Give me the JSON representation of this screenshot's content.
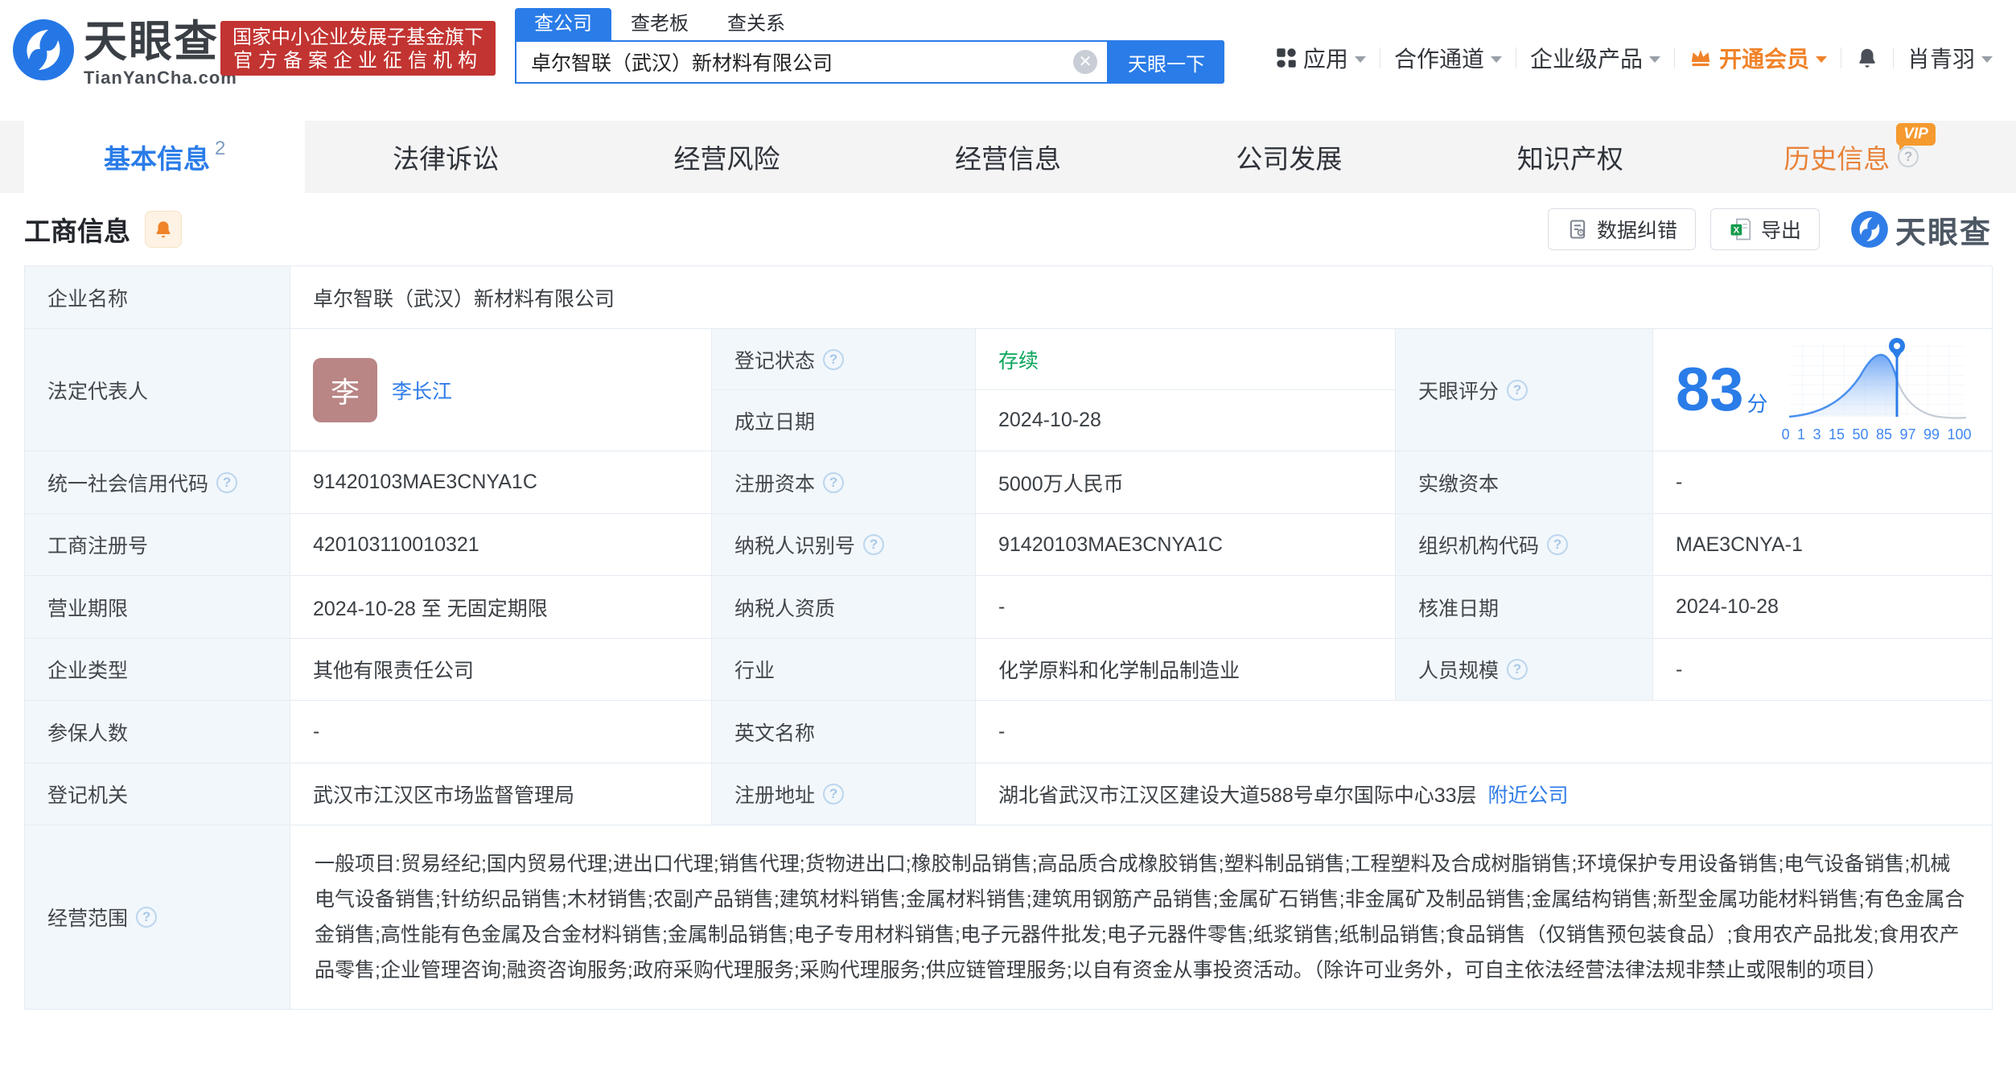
{
  "header": {
    "brand": {
      "name": "天眼查",
      "domain": "TianYanCha.com"
    },
    "badge": {
      "line1": "国家中小企业发展子基金旗下",
      "line2": "官方备案企业征信机构"
    },
    "search": {
      "tabs": [
        {
          "label": "查公司"
        },
        {
          "label": "查老板"
        },
        {
          "label": "查关系"
        }
      ],
      "value": "卓尔智联（武汉）新材料有限公司",
      "button": "天眼一下"
    },
    "nav": {
      "apps": "应用",
      "partner": "合作通道",
      "enterprise": "企业级产品",
      "vip": "开通会员",
      "user": "肖青羽"
    }
  },
  "tabs": [
    {
      "label": "基本信息",
      "count": "2"
    },
    {
      "label": "法律诉讼"
    },
    {
      "label": "经营风险"
    },
    {
      "label": "经营信息"
    },
    {
      "label": "公司发展"
    },
    {
      "label": "知识产权"
    },
    {
      "label": "历史信息",
      "badge": "VIP"
    }
  ],
  "section": {
    "title": "工商信息",
    "correct_button": "数据纠错",
    "export_button": "导出",
    "watermark": "天眼查"
  },
  "fields": {
    "company_name": {
      "label": "企业名称",
      "value": "卓尔智联（武汉）新材料有限公司"
    },
    "legal_rep": {
      "label": "法定代表人",
      "avatar_char": "李",
      "name": "李长江"
    },
    "reg_status": {
      "label": "登记状态",
      "value": "存续"
    },
    "establish_date": {
      "label": "成立日期",
      "value": "2024-10-28"
    },
    "score": {
      "label": "天眼评分",
      "value": "83",
      "unit": "分",
      "axis": [
        "0",
        "1",
        "3",
        "15",
        "50",
        "85",
        "97",
        "99",
        "100"
      ]
    },
    "credit_code": {
      "label": "统一社会信用代码",
      "value": "91420103MAE3CNYA1C"
    },
    "reg_capital": {
      "label": "注册资本",
      "value": "5000万人民币"
    },
    "paid_capital": {
      "label": "实缴资本",
      "value": "-"
    },
    "reg_no": {
      "label": "工商注册号",
      "value": "420103110010321"
    },
    "taxpayer_no": {
      "label": "纳税人识别号",
      "value": "91420103MAE3CNYA1C"
    },
    "org_code": {
      "label": "组织机构代码",
      "value": "MAE3CNYA-1"
    },
    "term": {
      "label": "营业期限",
      "value": "2024-10-28 至 无固定期限"
    },
    "taxpayer_qualification": {
      "label": "纳税人资质",
      "value": "-"
    },
    "approve_date": {
      "label": "核准日期",
      "value": "2024-10-28"
    },
    "company_type": {
      "label": "企业类型",
      "value": "其他有限责任公司"
    },
    "industry": {
      "label": "行业",
      "value": "化学原料和化学制品制造业"
    },
    "staff_scale": {
      "label": "人员规模",
      "value": "-"
    },
    "insured_num": {
      "label": "参保人数",
      "value": "-"
    },
    "english_name": {
      "label": "英文名称",
      "value": "-"
    },
    "registry": {
      "label": "登记机关",
      "value": "武汉市江汉区市场监督管理局"
    },
    "address": {
      "label": "注册地址",
      "value": "湖北省武汉市江汉区建设大道588号卓尔国际中心33层",
      "nearby_link": "附近公司"
    },
    "scope": {
      "label": "经营范围",
      "value": "一般项目:贸易经纪;国内贸易代理;进出口代理;销售代理;货物进出口;橡胶制品销售;高品质合成橡胶销售;塑料制品销售;工程塑料及合成树脂销售;环境保护专用设备销售;电气设备销售;机械电气设备销售;针纺织品销售;木材销售;农副产品销售;建筑材料销售;金属材料销售;建筑用钢筋产品销售;金属矿石销售;非金属矿及制品销售;金属结构销售;新型金属功能材料销售;有色金属合金销售;高性能有色金属及合金材料销售;金属制品销售;电子专用材料销售;电子元器件批发;电子元器件零售;纸浆销售;纸制品销售;食品销售（仅销售预包装食品）;食用农产品批发;食用农产品零售;企业管理咨询;融资咨询服务;政府采购代理服务;采购代理服务;供应链管理服务;以自有资金从事投资活动。（除许可业务外，可自主依法经营法律法规非禁止或限制的项目）"
    }
  }
}
